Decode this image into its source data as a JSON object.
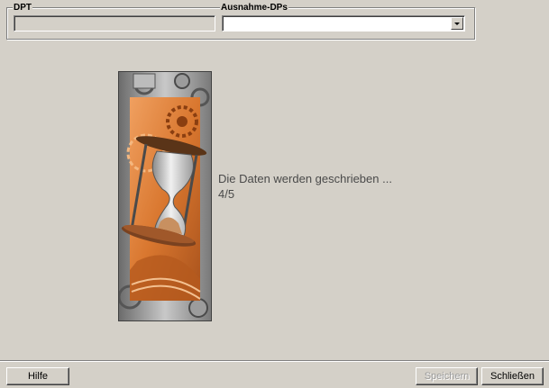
{
  "groupbox": {
    "dpt_label": "DPT",
    "dpt_value": "",
    "ausnahme_label": "Ausnahme-DPs",
    "ausnahme_value": ""
  },
  "status": {
    "message": "Die Daten werden geschrieben ...",
    "progress": "4/5"
  },
  "buttons": {
    "help": "Hilfe",
    "save": "Speichern",
    "close": "Schließen"
  },
  "icons": {
    "hourglass": "hourglass-gears-image",
    "dropdown": "chevron-down-icon"
  },
  "colors": {
    "background": "#d4d0c8",
    "accent_orange": "#d9772f",
    "status_text": "#4a4a4a"
  }
}
